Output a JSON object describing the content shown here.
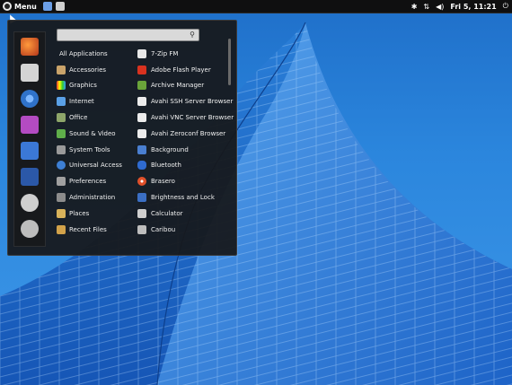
{
  "panel": {
    "menu_label": "Menu",
    "clock": "Fri 5, 11:21",
    "tray_icons": [
      "bluetooth-icon",
      "network-icon",
      "volume-icon",
      "power-icon"
    ]
  },
  "menu": {
    "search": {
      "value": "",
      "placeholder": ""
    },
    "favorites": [
      "firefox-icon",
      "files-icon",
      "chromium-icon",
      "media-icon",
      "settings-icon",
      "terminal-icon",
      "logout-icon",
      "shutdown-icon"
    ],
    "categories": [
      {
        "label": "All Applications",
        "icon": "none"
      },
      {
        "label": "Accessories",
        "icon": "accessories-icon"
      },
      {
        "label": "Graphics",
        "icon": "graphics-icon"
      },
      {
        "label": "Internet",
        "icon": "internet-icon"
      },
      {
        "label": "Office",
        "icon": "office-icon"
      },
      {
        "label": "Sound & Video",
        "icon": "sound-video-icon"
      },
      {
        "label": "System Tools",
        "icon": "system-tools-icon"
      },
      {
        "label": "Universal Access",
        "icon": "universal-access-icon"
      },
      {
        "label": "Preferences",
        "icon": "preferences-icon"
      },
      {
        "label": "Administration",
        "icon": "administration-icon"
      },
      {
        "label": "Places",
        "icon": "places-icon"
      },
      {
        "label": "Recent Files",
        "icon": "recent-files-icon"
      }
    ],
    "apps": [
      {
        "label": "7-Zip FM",
        "icon": "7zip-icon"
      },
      {
        "label": "Adobe Flash Player",
        "icon": "flash-icon"
      },
      {
        "label": "Archive Manager",
        "icon": "archive-icon"
      },
      {
        "label": "Avahi SSH Server Browser",
        "icon": "avahi-ssh-icon"
      },
      {
        "label": "Avahi VNC Server Browser",
        "icon": "avahi-vnc-icon"
      },
      {
        "label": "Avahi Zeroconf Browser",
        "icon": "avahi-zeroconf-icon"
      },
      {
        "label": "Background",
        "icon": "background-icon"
      },
      {
        "label": "Bluetooth",
        "icon": "bluetooth-icon"
      },
      {
        "label": "Brasero",
        "icon": "brasero-icon"
      },
      {
        "label": "Brightness and Lock",
        "icon": "brightness-icon"
      },
      {
        "label": "Calculator",
        "icon": "calculator-icon"
      },
      {
        "label": "Caribou",
        "icon": "caribou-icon"
      }
    ]
  }
}
